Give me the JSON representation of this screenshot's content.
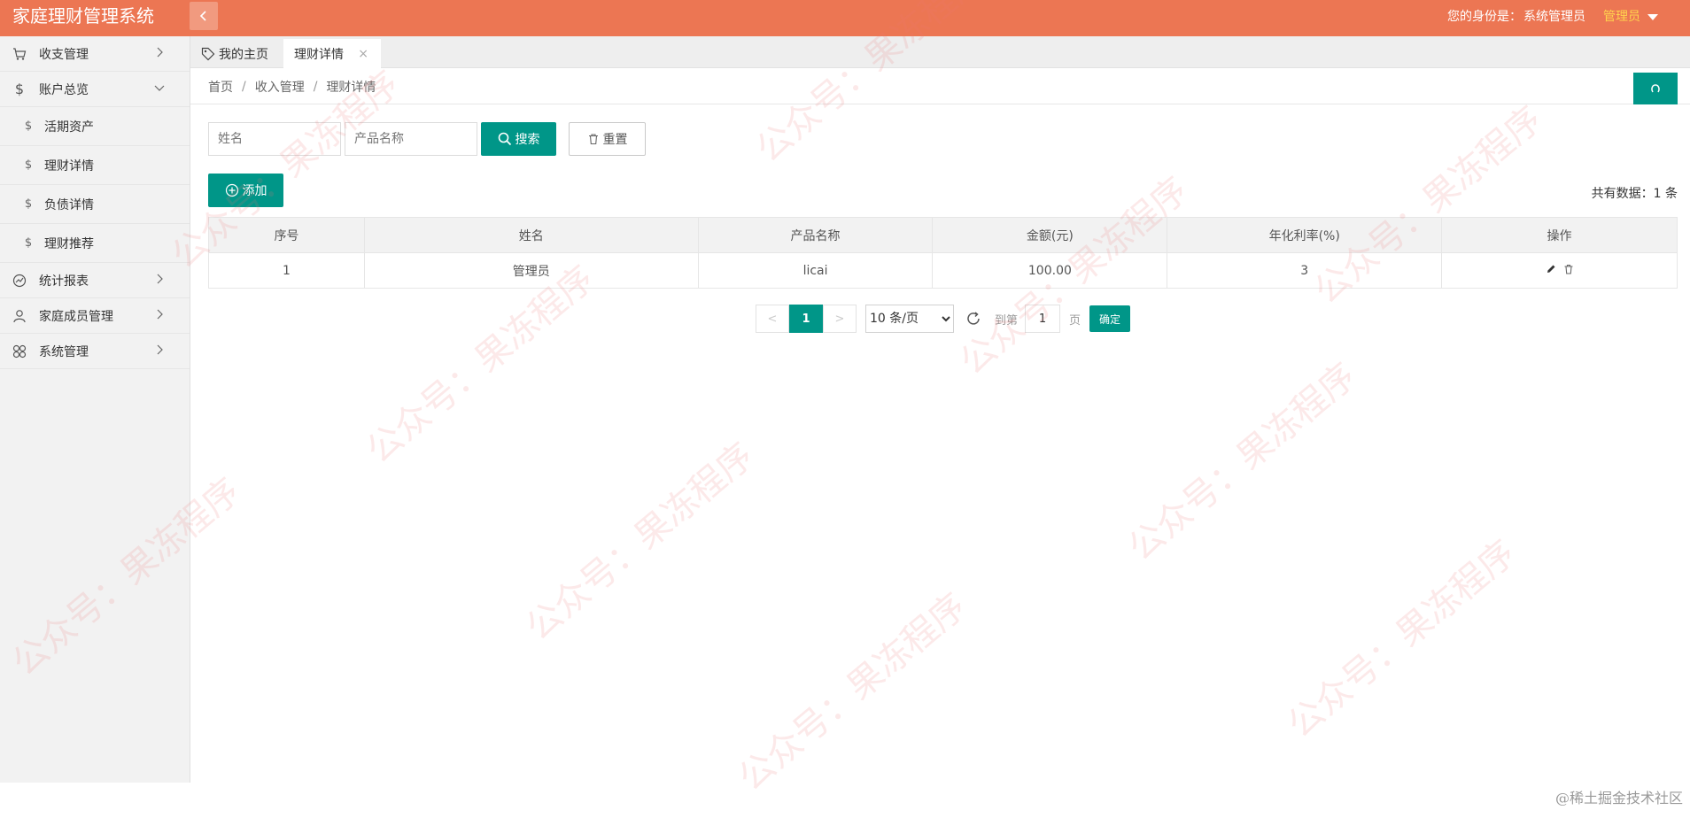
{
  "header": {
    "logo": "家庭理财管理系统",
    "identity_label": "您的身份是：",
    "identity_value": "系统管理员",
    "user": "管理员"
  },
  "sidebar": {
    "items": [
      {
        "label": "收支管理",
        "icon": "cart-icon"
      },
      {
        "label": "账户总览",
        "icon": "dollar-icon"
      },
      {
        "label": "统计报表",
        "icon": "chart-icon"
      },
      {
        "label": "家庭成员管理",
        "icon": "user-icon"
      },
      {
        "label": "系统管理",
        "icon": "grid-icon"
      }
    ],
    "sub_items": [
      {
        "label": "活期资产"
      },
      {
        "label": "理财详情"
      },
      {
        "label": "负债详情"
      },
      {
        "label": "理财推荐"
      }
    ]
  },
  "tabs": {
    "home": "我的主页",
    "active": "理财详情",
    "close": "×"
  },
  "breadcrumb": [
    "首页",
    "收入管理",
    "理财详情"
  ],
  "breadcrumb_sep": "/",
  "search": {
    "name_placeholder": "姓名",
    "product_placeholder": "产品名称",
    "search_label": "搜索",
    "reset_label": "重置"
  },
  "add_label": "添加",
  "total": "共有数据：1 条",
  "table": {
    "headers": [
      "序号",
      "姓名",
      "产品名称",
      "金额(元)",
      "年化利率(%)",
      "操作"
    ],
    "rows": [
      {
        "no": "1",
        "name": "管理员",
        "product": "licai",
        "amount": "100.00",
        "rate": "3"
      }
    ]
  },
  "pagination": {
    "prev": "<",
    "current": "1",
    "next": ">",
    "page_size": "10 条/页",
    "goto_label": "到第",
    "goto_value": "1",
    "page_label": "页",
    "confirm": "确定"
  },
  "watermark": "公众号：果冻程序",
  "footer_mark": "@稀土掘金技术社区",
  "colors": {
    "header": "#ec7653",
    "primary": "#009688",
    "user": "#ffd34d"
  }
}
